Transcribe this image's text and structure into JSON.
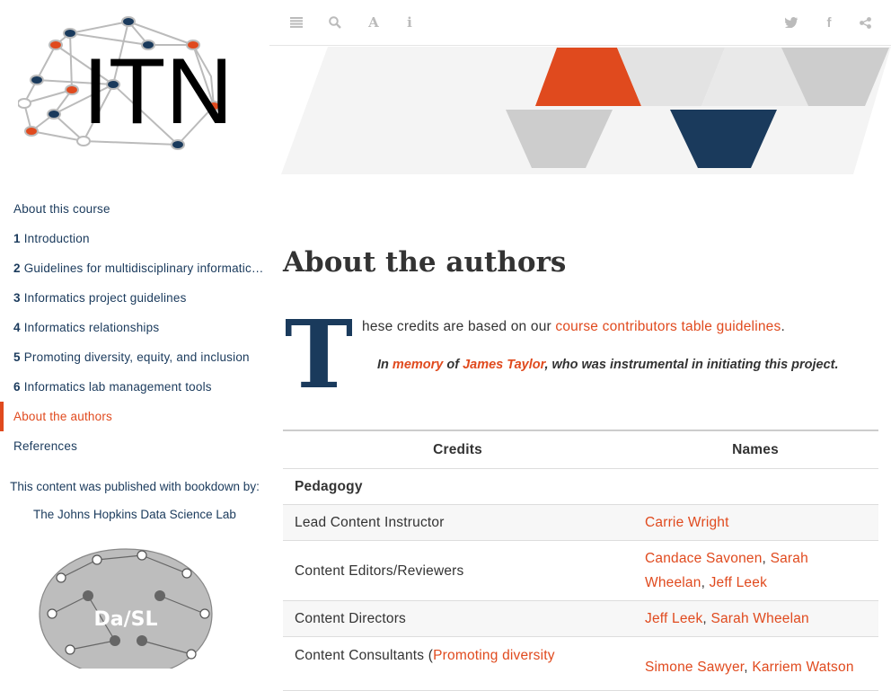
{
  "logo": {
    "text": "ITN"
  },
  "toc": {
    "items": [
      {
        "num": "",
        "label": "About this course"
      },
      {
        "num": "1",
        "label": "Introduction"
      },
      {
        "num": "2",
        "label": "Guidelines for multidisciplinary informatics research"
      },
      {
        "num": "3",
        "label": "Informatics project guidelines"
      },
      {
        "num": "4",
        "label": "Informatics relationships"
      },
      {
        "num": "5",
        "label": "Promoting diversity, equity, and inclusion"
      },
      {
        "num": "6",
        "label": "Informatics lab management tools"
      },
      {
        "num": "",
        "label": "About the authors"
      },
      {
        "num": "",
        "label": "References"
      }
    ],
    "active_index": 7
  },
  "published": {
    "text": "This content was published with bookdown by:",
    "lab": "The Johns Hopkins Data Science Lab"
  },
  "dsl_logo": {
    "text": "Da/SL"
  },
  "toolbar": {
    "left_icons": [
      "list-icon",
      "search-icon",
      "font-icon",
      "info-icon"
    ],
    "right_icons": [
      "twitter-icon",
      "facebook-icon",
      "share-icon"
    ]
  },
  "page": {
    "title": "About the authors",
    "dropcap": "T",
    "intro_text": "hese credits are based on our ",
    "intro_link": "course contributors table guidelines",
    "intro_end": ".",
    "memory": {
      "in": "In ",
      "memory_link": "memory",
      "of": " of ",
      "name_link": "James Taylor",
      "rest": ", who was instrumental in initiating this project."
    }
  },
  "credits_table": {
    "headers": [
      "Credits",
      "Names"
    ],
    "section": "Pedagogy",
    "rows": {
      "lead": {
        "label": "Lead Content Instructor",
        "names": [
          "Carrie Wright"
        ]
      },
      "editors": {
        "label": "Content Editors/Reviewers",
        "names": [
          "Candace Savonen",
          "Sarah Wheelan",
          "Jeff Leek"
        ]
      },
      "directors": {
        "label": "Content Directors",
        "names": [
          "Jeff Leek",
          "Sarah Wheelan"
        ]
      },
      "consultants": {
        "label_prefix": "Content Consultants (",
        "label_link": "Promoting diversity",
        "names": [
          "Simone Sawyer",
          "Karriem Watson"
        ]
      }
    }
  },
  "colors": {
    "accent": "#e04a1e",
    "navy": "#1a3a5c",
    "grey": "#cccccc"
  }
}
